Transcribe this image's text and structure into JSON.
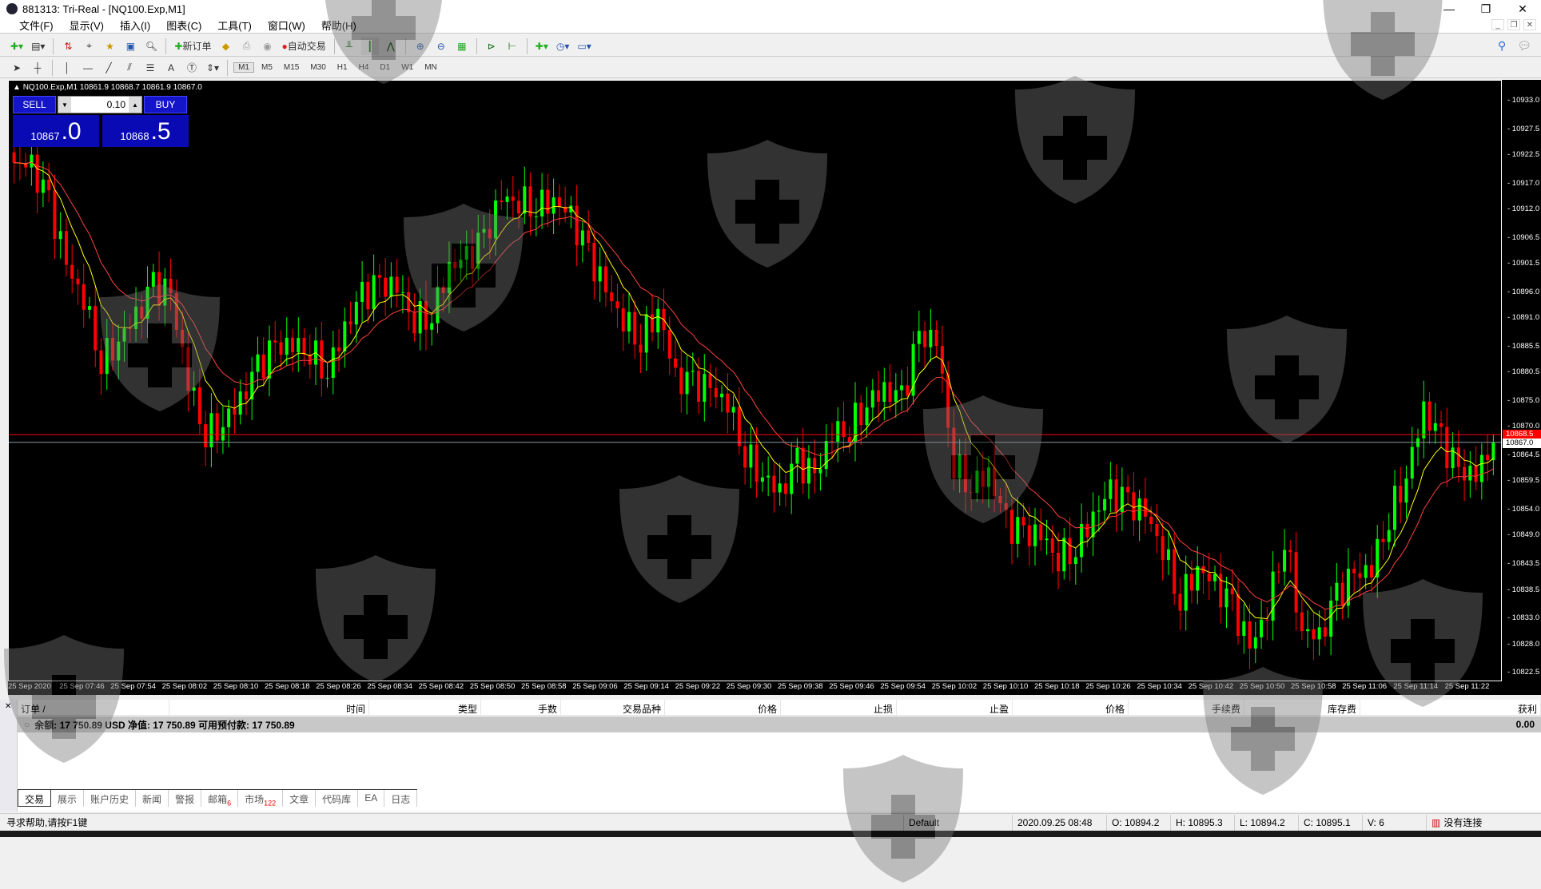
{
  "window": {
    "title": "881313: Tri-Real - [NQ100.Exp,M1]"
  },
  "menu": [
    "文件(F)",
    "显示(V)",
    "插入(I)",
    "图表(C)",
    "工具(T)",
    "窗口(W)",
    "帮助(H)"
  ],
  "toolbar": {
    "new_order": "新订单",
    "auto_trading": "自动交易",
    "timeframes": [
      "M1",
      "M5",
      "M15",
      "M30",
      "H1",
      "H4",
      "D1",
      "W1",
      "MN"
    ],
    "active_timeframe": "M1"
  },
  "chart": {
    "info": "NQ100.Exp,M1  10861.9 10868.7 10861.9 10867.0",
    "sell_label": "SELL",
    "buy_label": "BUY",
    "lot": "0.10",
    "sell_price_main": "10867",
    "sell_price_frac": ".0",
    "buy_price_main": "10868",
    "buy_price_frac": ".5",
    "ask_tag": "10868.5",
    "bid_tag": "10867.0",
    "colors": {
      "bull": "#00ff00",
      "bear": "#ff0000",
      "ma_fast": "#ffff00",
      "ma_slow": "#ff4040",
      "bid_line": "#8a9aaa",
      "ask_line": "#ff0000"
    }
  },
  "chart_data": {
    "type": "candlestick",
    "symbol": "NQ100.Exp",
    "timeframe": "M1",
    "ylim": [
      10821,
      10937
    ],
    "y_ticks": [
      "10933.0",
      "10927.5",
      "10922.5",
      "10917.0",
      "10912.0",
      "10906.5",
      "10901.5",
      "10896.0",
      "10891.0",
      "10885.5",
      "10880.5",
      "10875.0",
      "10870.0",
      "10864.5",
      "10859.5",
      "10854.0",
      "10849.0",
      "10843.5",
      "10838.5",
      "10833.0",
      "10828.0",
      "10822.5"
    ],
    "x_ticks": [
      "25 Sep 2020",
      "25 Sep 07:46",
      "25 Sep 07:54",
      "25 Sep 08:02",
      "25 Sep 08:10",
      "25 Sep 08:18",
      "25 Sep 08:26",
      "25 Sep 08:34",
      "25 Sep 08:42",
      "25 Sep 08:50",
      "25 Sep 08:58",
      "25 Sep 09:06",
      "25 Sep 09:14",
      "25 Sep 09:22",
      "25 Sep 09:30",
      "25 Sep 09:38",
      "25 Sep 09:46",
      "25 Sep 09:54",
      "25 Sep 10:02",
      "25 Sep 10:10",
      "25 Sep 10:18",
      "25 Sep 10:26",
      "25 Sep 10:34",
      "25 Sep 10:42",
      "25 Sep 10:50",
      "25 Sep 10:58",
      "25 Sep 11:06",
      "25 Sep 11:14",
      "25 Sep 11:22"
    ],
    "closes": [
      10921,
      10920,
      10913,
      10901,
      10895,
      10883,
      10887,
      10891,
      10897,
      10895,
      10879,
      10869,
      10871,
      10875,
      10881,
      10885,
      10886,
      10885,
      10881,
      10889,
      10895,
      10897,
      10897,
      10891,
      10892,
      10901,
      10902,
      10906,
      10914,
      10914,
      10913,
      10914,
      10910,
      10903,
      10896,
      10891,
      10887,
      10893,
      10879,
      10878,
      10877,
      10875,
      10865,
      10861,
      10857,
      10863,
      10860,
      10869,
      10870,
      10875,
      10877,
      10875,
      10887,
      10887,
      10863,
      10859,
      10861,
      10851,
      10849,
      10849,
      10845,
      10847,
      10853,
      10857,
      10855,
      10853,
      10847,
      10837,
      10843,
      10839,
      10835,
      10827,
      10835,
      10849,
      10831,
      10829,
      10837,
      10841,
      10843,
      10853,
      10861,
      10873,
      10867,
      10861,
      10861,
      10867
    ],
    "bid": 10867.0,
    "ask": 10868.5
  },
  "terminal": {
    "columns": [
      "订单 /",
      "时间",
      "类型",
      "手数",
      "交易品种",
      "价格",
      "止损",
      "止盈",
      "价格",
      "手续费",
      "库存费",
      "获利"
    ],
    "balance_text": "余额: 17 750.89 USD  净值: 17 750.89  可用预付款: 17 750.89",
    "profit": "0.00",
    "tabs": [
      {
        "label": "交易"
      },
      {
        "label": "展示"
      },
      {
        "label": "账户历史"
      },
      {
        "label": "新闻"
      },
      {
        "label": "警报"
      },
      {
        "label": "邮箱",
        "badge": "6"
      },
      {
        "label": "市场",
        "badge": "122"
      },
      {
        "label": "文章"
      },
      {
        "label": "代码库"
      },
      {
        "label": "EA"
      },
      {
        "label": "日志"
      }
    ]
  },
  "status": {
    "help": "寻求帮助,请按F1键",
    "profile": "Default",
    "datetime": "2020.09.25 08:48",
    "open": "O: 10894.2",
    "high": "H: 10895.3",
    "low": "L: 10894.2",
    "close": "C: 10895.1",
    "volume": "V: 6",
    "connection": "没有连接"
  }
}
